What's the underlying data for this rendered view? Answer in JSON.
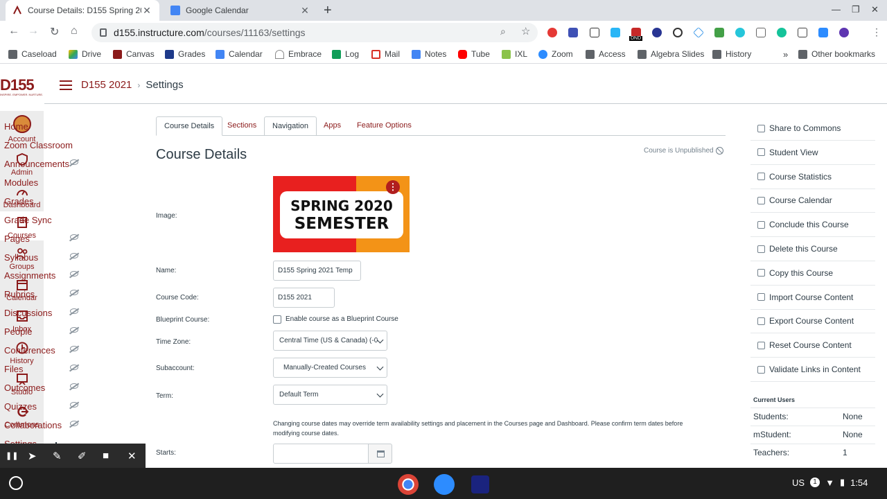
{
  "browser": {
    "tabs": [
      {
        "title": "Course Details: D155 Spring 202",
        "active": true
      },
      {
        "title": "Google Calendar",
        "active": false
      }
    ],
    "new_tab_symbol": "+",
    "close_symbol": "✕",
    "url_host": "d155.instructure.com",
    "url_path": "/courses/11163/settings",
    "window_controls": [
      "—",
      "❐",
      "✕"
    ],
    "bookmarks": [
      "Caseload",
      "Drive",
      "Canvas",
      "Grades",
      "Calendar",
      "Embrace",
      "Log",
      "Mail",
      "Notes",
      "Tube",
      "IXL",
      "Zoom",
      "Access",
      "Algebra Slides",
      "History"
    ],
    "bookmarks_overflow": "»",
    "other_bookmarks": "Other bookmarks",
    "dnd_badge": "DND"
  },
  "logo": {
    "text": "D155",
    "tagline": "INSPIRE. EMPOWER. NURTURE."
  },
  "global_nav": [
    "Account",
    "Admin",
    "Dashboard",
    "Courses",
    "Groups",
    "Calendar",
    "Inbox",
    "History",
    "Studio",
    "Commons"
  ],
  "breadcrumb": {
    "course": "D155 2021",
    "separator": "›",
    "current": "Settings"
  },
  "course_nav": [
    {
      "label": "Home",
      "hidden": false
    },
    {
      "label": "Zoom Classroom",
      "hidden": false
    },
    {
      "label": "Announcements",
      "hidden": true
    },
    {
      "label": "Modules",
      "hidden": false
    },
    {
      "label": "Grades",
      "hidden": false
    },
    {
      "label": "Grade Sync",
      "hidden": false
    },
    {
      "label": "Pages",
      "hidden": true
    },
    {
      "label": "Syllabus",
      "hidden": true
    },
    {
      "label": "Assignments",
      "hidden": true
    },
    {
      "label": "Rubrics",
      "hidden": true
    },
    {
      "label": "Discussions",
      "hidden": true
    },
    {
      "label": "People",
      "hidden": true
    },
    {
      "label": "Conferences",
      "hidden": true
    },
    {
      "label": "Files",
      "hidden": true
    },
    {
      "label": "Outcomes",
      "hidden": true
    },
    {
      "label": "Quizzes",
      "hidden": true
    },
    {
      "label": "Collaborations",
      "hidden": true
    },
    {
      "label": "Settings",
      "hidden": false
    }
  ],
  "settings_tabs": [
    "Course Details",
    "Sections",
    "Navigation",
    "Apps",
    "Feature Options"
  ],
  "main": {
    "title": "Course Details",
    "unpublished": "Course is Unpublished",
    "image_label": "Image:",
    "image_text_line1": "SPRING 2020",
    "image_text_line2": "SEMESTER",
    "image_menu": "⋮",
    "name_label": "Name:",
    "name_value": "D155 Spring 2021 Temp",
    "code_label": "Course Code:",
    "code_value": "D155 2021",
    "blueprint_label": "Blueprint Course:",
    "blueprint_checkbox": "Enable course as a Blueprint Course",
    "timezone_label": "Time Zone:",
    "timezone_value": "Central Time (US & Canada) (-0",
    "subaccount_label": "Subaccount:",
    "subaccount_value": "Manually-Created Courses",
    "term_label": "Term:",
    "term_value": "Default Term",
    "dates_note": "Changing course dates may override term availability settings and placement in the Courses page and Dashboard. Please confirm term dates before modifying course dates.",
    "starts_label": "Starts:",
    "starts_value": ""
  },
  "sidebar": {
    "actions": [
      "Share to Commons",
      "Student View",
      "Course Statistics",
      "Course Calendar",
      "Conclude this Course",
      "Delete this Course",
      "Copy this Course",
      "Import Course Content",
      "Export Course Content",
      "Reset Course Content",
      "Validate Links in Content"
    ],
    "current_users_title": "Current Users",
    "users": [
      {
        "role": "Students:",
        "count": "None"
      },
      {
        "role": "mStudent:",
        "count": "None"
      },
      {
        "role": "Teachers:",
        "count": "1"
      }
    ]
  },
  "annotation_toolbar": [
    "❚❚",
    "➤",
    "✎",
    "✐",
    "■",
    "✕"
  ],
  "shelf": {
    "locale": "US",
    "notification_count": "1",
    "time": "1:54"
  },
  "colors": {
    "canvas_brand": "#8b1a1a",
    "nav_bg": "#ececec",
    "shelf_bg": "#1f1f1f"
  }
}
